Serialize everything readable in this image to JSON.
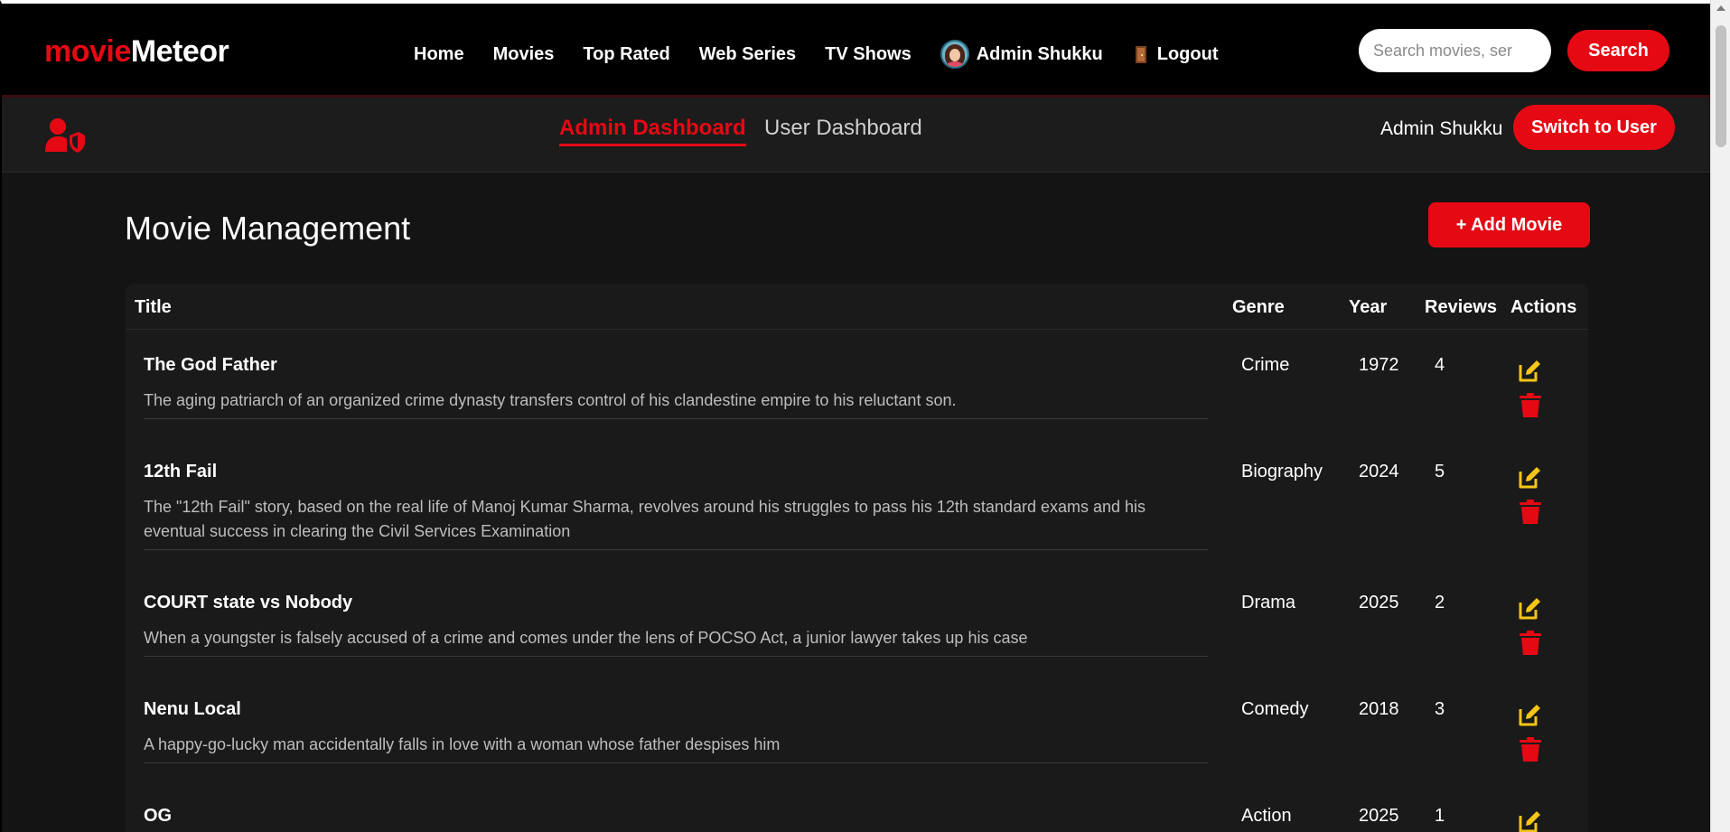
{
  "brand": {
    "part1": "movie",
    "part2": "Meteor"
  },
  "nav": {
    "links": [
      "Home",
      "Movies",
      "Top Rated",
      "Web Series",
      "TV Shows"
    ],
    "user_name": "Admin Shukku",
    "logout_label": "Logout"
  },
  "search": {
    "placeholder": "Search movies, ser",
    "button_label": "Search"
  },
  "subheader": {
    "tab_admin": "Admin Dashboard",
    "tab_user": "User Dashboard",
    "user_name": "Admin Shukku",
    "switch_label": "Switch to User"
  },
  "main": {
    "title": "Movie Management",
    "add_label": "+ Add Movie",
    "columns": {
      "title": "Title",
      "genre": "Genre",
      "year": "Year",
      "reviews": "Reviews",
      "actions": "Actions"
    },
    "movies": [
      {
        "title": "The God Father",
        "description": "The aging patriarch of an organized crime dynasty transfers control of his clandestine empire to his reluctant son.",
        "genre": "Crime",
        "year": "1972",
        "reviews": "4"
      },
      {
        "title": "12th Fail",
        "description": "The \"12th Fail\" story, based on the real life of Manoj Kumar Sharma, revolves around his struggles to pass his 12th standard exams and his eventual success in clearing the Civil Services Examination",
        "genre": "Biography",
        "year": "2024",
        "reviews": "5"
      },
      {
        "title": "COURT state vs Nobody",
        "description": "When a youngster is falsely accused of a crime and comes under the lens of POCSO Act, a junior lawyer takes up his case",
        "genre": "Drama",
        "year": "2025",
        "reviews": "2"
      },
      {
        "title": "Nenu Local",
        "description": "A happy-go-lucky man accidentally falls in love with a woman whose father despises him",
        "genre": "Comedy",
        "year": "2018",
        "reviews": "3"
      },
      {
        "title": "OG",
        "description": "",
        "genre": "Action",
        "year": "2025",
        "reviews": "1"
      }
    ]
  },
  "colors": {
    "accent": "#e50914",
    "edit": "#f5c518",
    "background": "#141414"
  },
  "icons": {
    "admin": "user-shield-icon",
    "edit": "edit-icon",
    "delete": "trash-icon",
    "logout": "door-icon"
  }
}
